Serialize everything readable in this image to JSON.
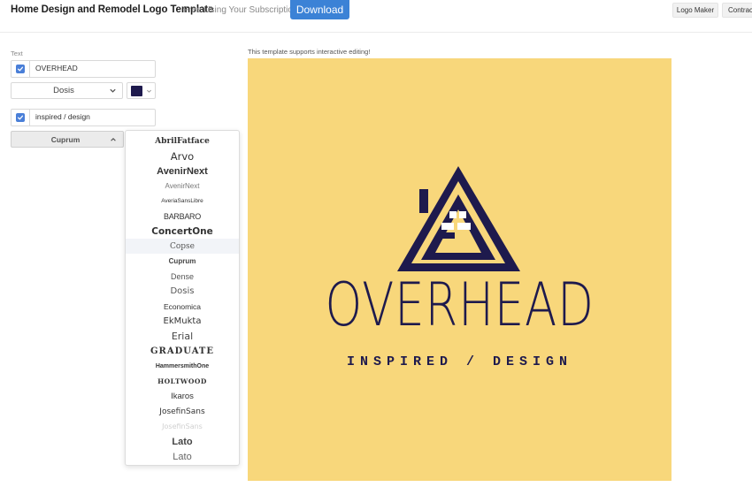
{
  "header": {
    "title": "Home Design and Remodel Logo Template",
    "subtitle": "Free Using Your Subscription!",
    "download_label": "Download",
    "nav": {
      "logo_maker": "Logo Maker",
      "contract": "Contract"
    }
  },
  "editor": {
    "section_label": "Text",
    "line1": {
      "checked": true,
      "value": "OVERHEAD",
      "font": "Dosis",
      "color": "#1e1a4d"
    },
    "line2": {
      "checked": true,
      "value": "inspired / design",
      "font": "Cuprum"
    }
  },
  "font_dropdown": {
    "highlighted": "Copse",
    "options": [
      "AbrilFatface",
      "Arvo",
      "AvenirNext",
      "AvenirNext",
      "AveriaSansLibre",
      "BARBARO",
      "ConcertOne",
      "Copse",
      "Cuprum",
      "Dense",
      "Dosis",
      "Economica",
      "EkMukta",
      "Erial",
      "GRADUATE",
      "HammersmithOne",
      "HOLTWOOD",
      "Ikaros",
      "JosefinSans",
      "JosefinSans",
      "Lato",
      "Lato"
    ]
  },
  "preview": {
    "hint": "This template supports interactive editing!",
    "background": "#f8d77b",
    "logo_primary": "#1e1a4d",
    "brand_name": "OVERHEAD",
    "tagline": "INSPIRED / DESIGN"
  }
}
